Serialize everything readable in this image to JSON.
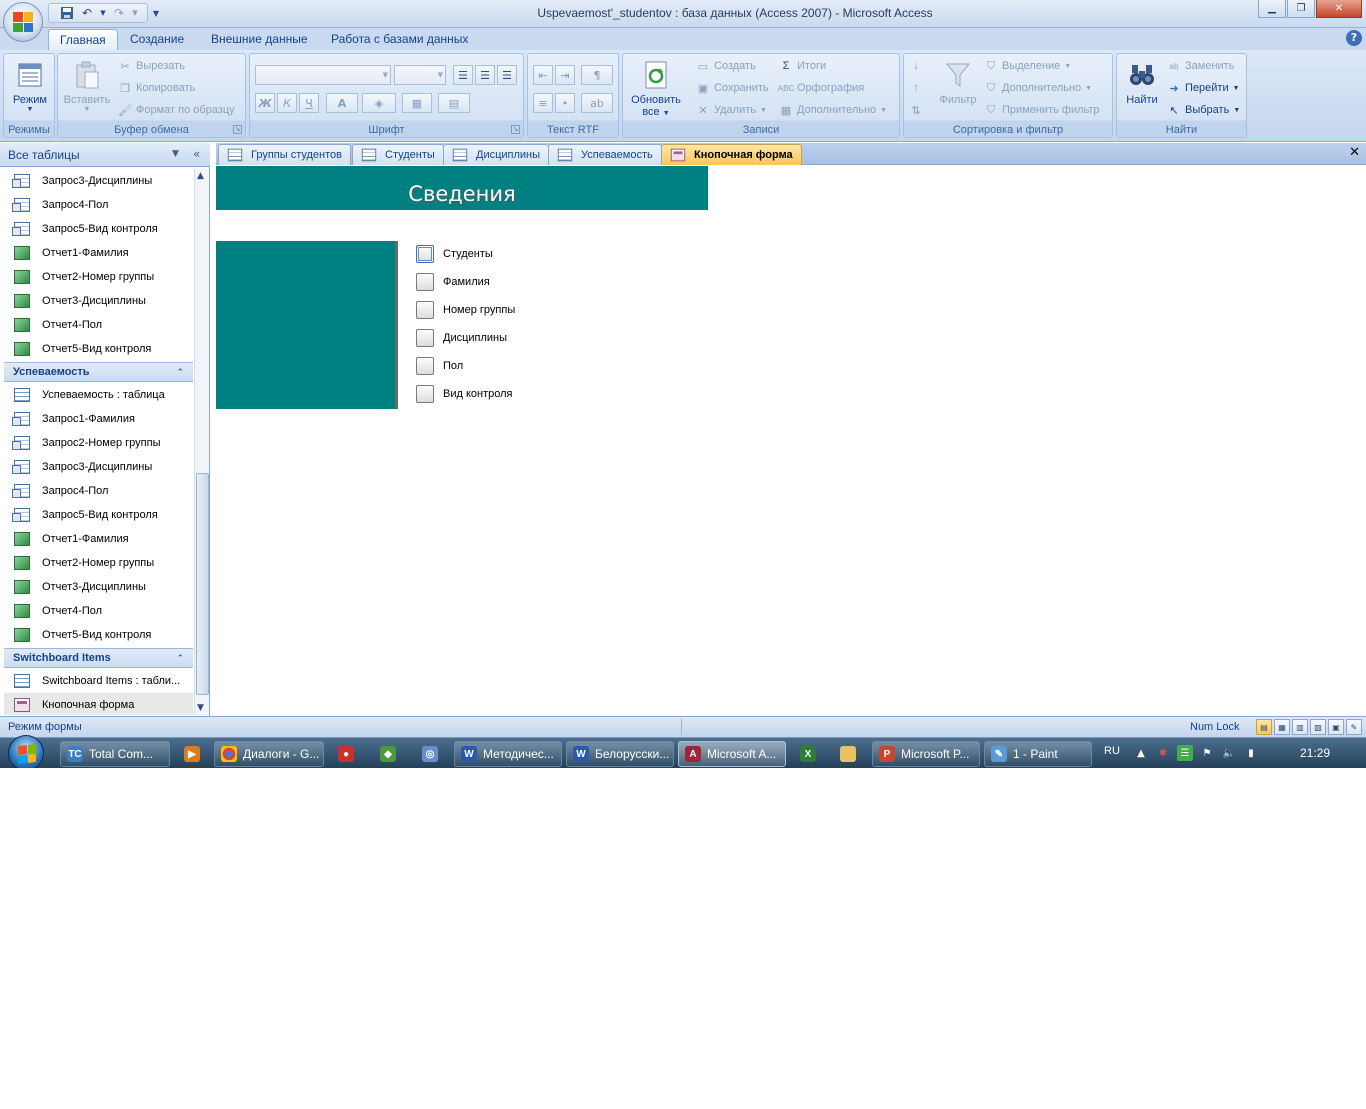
{
  "window": {
    "title": "Uspevaemost'_studentov : база данных (Access 2007) - Microsoft Access"
  },
  "ribbon": {
    "tabs": [
      "Главная",
      "Создание",
      "Внешние данные",
      "Работа с базами данных"
    ],
    "groups": {
      "modes": {
        "label": "Режимы",
        "mode_button": "Режим"
      },
      "clipboard": {
        "label": "Буфер обмена",
        "paste": "Вставить",
        "cut": "Вырезать",
        "copy": "Копировать",
        "format_painter": "Формат по образцу"
      },
      "font": {
        "label": "Шрифт",
        "bold": "Ж",
        "italic": "К",
        "underline": "Ч"
      },
      "rtf": {
        "label": "Текст RTF"
      },
      "records": {
        "label": "Записи",
        "refresh_line1": "Обновить",
        "refresh_line2": "все",
        "new": "Создать",
        "save": "Сохранить",
        "delete": "Удалить",
        "totals": "Итоги",
        "spelling": "Орфография",
        "more": "Дополнительно"
      },
      "sort_filter": {
        "label": "Сортировка и фильтр",
        "filter": "Фильтр",
        "selection": "Выделение",
        "advanced": "Дополнительно",
        "apply_filter": "Применить фильтр"
      },
      "find": {
        "label": "Найти",
        "find": "Найти",
        "replace": "Заменить",
        "goto": "Перейти",
        "select": "Выбрать"
      }
    }
  },
  "nav": {
    "title": "Все таблицы",
    "items_top": [
      {
        "label": "Запрос3-Дисциплины",
        "type": "query"
      },
      {
        "label": "Запрос4-Пол",
        "type": "query"
      },
      {
        "label": "Запрос5-Вид контроля",
        "type": "query"
      },
      {
        "label": "Отчет1-Фамилия",
        "type": "report"
      },
      {
        "label": "Отчет2-Номер группы",
        "type": "report"
      },
      {
        "label": "Отчет3-Дисциплины",
        "type": "report"
      },
      {
        "label": "Отчет4-Пол",
        "type": "report"
      },
      {
        "label": "Отчет5-Вид контроля",
        "type": "report"
      }
    ],
    "group1": {
      "title": "Успеваемость",
      "items": [
        {
          "label": "Успеваемость : таблица",
          "type": "table"
        },
        {
          "label": "Запрос1-Фамилия",
          "type": "query"
        },
        {
          "label": "Запрос2-Номер группы",
          "type": "query"
        },
        {
          "label": "Запрос3-Дисциплины",
          "type": "query"
        },
        {
          "label": "Запрос4-Пол",
          "type": "query"
        },
        {
          "label": "Запрос5-Вид контроля",
          "type": "query"
        },
        {
          "label": "Отчет1-Фамилия",
          "type": "report"
        },
        {
          "label": "Отчет2-Номер группы",
          "type": "report"
        },
        {
          "label": "Отчет3-Дисциплины",
          "type": "report"
        },
        {
          "label": "Отчет4-Пол",
          "type": "report"
        },
        {
          "label": "Отчет5-Вид контроля",
          "type": "report"
        }
      ]
    },
    "group2": {
      "title": "Switchboard Items",
      "items": [
        {
          "label": "Switchboard Items : табли...",
          "type": "table"
        },
        {
          "label": "Кнопочная форма",
          "type": "form",
          "selected": true
        }
      ]
    }
  },
  "doc_tabs": [
    {
      "label": "Группы студентов",
      "type": "table"
    },
    {
      "label": "Студенты",
      "type": "table"
    },
    {
      "label": "Дисциплины",
      "type": "table"
    },
    {
      "label": "Успеваемость",
      "type": "table"
    },
    {
      "label": "Кнопочная форма",
      "type": "form",
      "active": true
    }
  ],
  "form": {
    "header_title": "Сведения",
    "buttons": [
      "Студенты",
      "Фамилия",
      "Номер группы",
      "Дисциплины",
      "Пол",
      "Вид контроля"
    ],
    "colors": {
      "teal": "#008080"
    }
  },
  "status": {
    "mode": "Режим формы",
    "numlock": "Num Lock"
  },
  "taskbar": {
    "items": [
      "Total Com...",
      "Диалоги - G...",
      "Методичес...",
      "Белорусски...",
      "Microsoft A...",
      "Microsoft P...",
      "1 - Paint"
    ],
    "lang": "RU",
    "clock": "21:29"
  }
}
